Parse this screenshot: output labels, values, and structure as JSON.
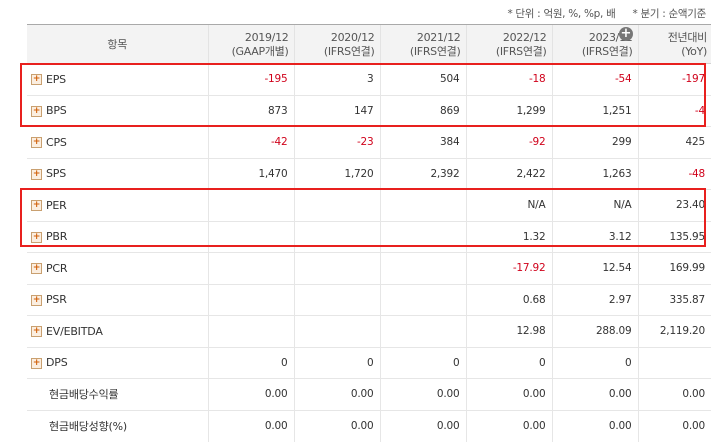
{
  "notes": {
    "unit": "* 단위 : 억원, %, %p, 배",
    "basis": "* 분기 : 순액기준"
  },
  "header": {
    "item_label": "항목",
    "columns": [
      {
        "line1": "2019/12",
        "line2": "(GAAP개별)"
      },
      {
        "line1": "2020/12",
        "line2": "(IFRS연결)"
      },
      {
        "line1": "2021/12",
        "line2": "(IFRS연결)"
      },
      {
        "line1": "2022/12",
        "line2": "(IFRS연결)"
      },
      {
        "line1": "2023/12",
        "line2": "(IFRS연결)"
      },
      {
        "line1": "전년대비",
        "line2": "(YoY)"
      }
    ]
  },
  "rows": [
    {
      "label": "EPS",
      "expand": true,
      "values": [
        "-195",
        "3",
        "504",
        "-18",
        "-54",
        "-197"
      ]
    },
    {
      "label": "BPS",
      "expand": true,
      "values": [
        "873",
        "147",
        "869",
        "1,299",
        "1,251",
        "-4"
      ]
    },
    {
      "label": "CPS",
      "expand": true,
      "values": [
        "-42",
        "-23",
        "384",
        "-92",
        "299",
        "425"
      ]
    },
    {
      "label": "SPS",
      "expand": true,
      "values": [
        "1,470",
        "1,720",
        "2,392",
        "2,422",
        "1,263",
        "-48"
      ]
    },
    {
      "label": "PER",
      "expand": true,
      "values": [
        "",
        "",
        "",
        "N/A",
        "N/A",
        "23.40"
      ]
    },
    {
      "label": "PBR",
      "expand": true,
      "values": [
        "",
        "",
        "",
        "1.32",
        "3.12",
        "135.95"
      ]
    },
    {
      "label": "PCR",
      "expand": true,
      "values": [
        "",
        "",
        "",
        "-17.92",
        "12.54",
        "169.99"
      ]
    },
    {
      "label": "PSR",
      "expand": true,
      "values": [
        "",
        "",
        "",
        "0.68",
        "2.97",
        "335.87"
      ]
    },
    {
      "label": "EV/EBITDA",
      "expand": true,
      "values": [
        "",
        "",
        "",
        "12.98",
        "288.09",
        "2,119.20"
      ]
    },
    {
      "label": "DPS",
      "expand": true,
      "values": [
        "0",
        "0",
        "0",
        "0",
        "0",
        ""
      ]
    },
    {
      "label": "현금배당수익률",
      "expand": false,
      "values": [
        "0.00",
        "0.00",
        "0.00",
        "0.00",
        "0.00",
        "0.00"
      ]
    },
    {
      "label": "현금배당성향(%)",
      "expand": false,
      "values": [
        "0.00",
        "0.00",
        "0.00",
        "0.00",
        "0.00",
        "0.00"
      ]
    }
  ],
  "colors": {
    "negative": "#d0021b",
    "highlight_box": "#e8201e",
    "header_bg": "#f3f3f3"
  }
}
